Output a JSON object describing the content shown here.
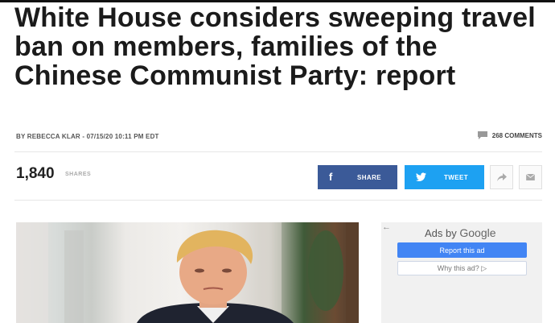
{
  "article": {
    "headline": "White House considers sweeping travel ban on members, families of the Chinese Communist Party: report",
    "byline": "BY REBECCA KLAR - 07/15/20 10:11 PM EDT",
    "comments_label": "268 COMMENTS"
  },
  "share_bar": {
    "count": "1,840",
    "count_label": "SHARES",
    "facebook_label": "SHARE",
    "facebook_icon": "f",
    "twitter_label": "TWEET",
    "twitter_icon": "twitter-bird-icon"
  },
  "ads": {
    "back_arrow": "←",
    "ads_by": "Ads by",
    "brand": "Google",
    "report_label": "Report this ad",
    "why_label": "Why this ad? ▷"
  },
  "colors": {
    "facebook": "#3b5a98",
    "twitter": "#1da1f2",
    "google_blue": "#4285f4"
  }
}
